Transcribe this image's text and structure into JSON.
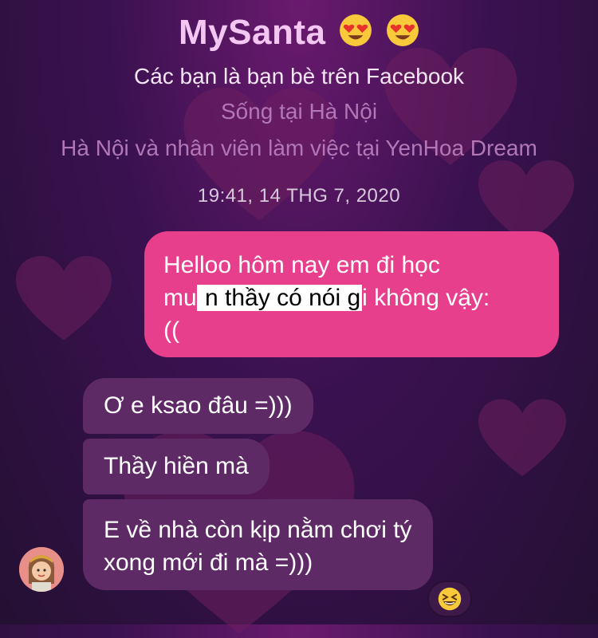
{
  "header": {
    "name": "MySanta",
    "emojis": [
      "heart-eyes-emoji",
      "heart-eyes-emoji"
    ],
    "line1": "Các bạn là bạn bè trên Facebook",
    "line2": "Sống tại Hà Nội",
    "line3": "Hà Nội và nhân viên làm việc tại YenHoa Dream"
  },
  "timestamp": "19:41, 14 THG 7, 2020",
  "messages": {
    "outgoing": {
      "line1": "Helloo hôm nay em đi học",
      "line2_pre": "mu",
      "line2_redacted": "  n thầy có nói g",
      "line2_post": "i không vậy:",
      "line3": "(("
    },
    "incoming": [
      {
        "text": "Ơ e ksao đâu =)))"
      },
      {
        "text": "Thầy hiền mà"
      },
      {
        "line1": "E về nhà còn kịp nằm chơi tý",
        "line2": "xong mới đi mà =)))"
      }
    ]
  },
  "reaction": {
    "icon": "grinning-squinting-emoji"
  },
  "colors": {
    "title": "#f4c7f2",
    "outgoing_bubble": "#e83f8d",
    "incoming_bubble": "#5e2a66",
    "background": "#3a1150"
  }
}
